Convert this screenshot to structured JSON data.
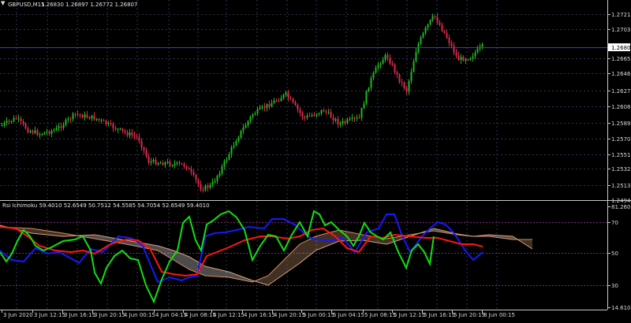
{
  "header": {
    "arrow_icon": "triangle-down-icon",
    "symbol": "GBPUSD,M15",
    "ohlc": "1.26830 1.26897 1.26772 1.26807"
  },
  "main_chart": {
    "price_ticks": [
      "1.27215",
      "1.27030",
      "1.26650",
      "1.26460",
      "1.26270",
      "1.26080",
      "1.25890",
      "1.25700",
      "1.25510",
      "1.25325",
      "1.25135",
      "1.24945"
    ],
    "current_price_label": "1.26807",
    "colors": {
      "bull": "#1fb81f",
      "bear": "#e0284d",
      "grid": "#2f3550",
      "axis": "#c8c8c8",
      "price_line": "#3d3dc0",
      "price_label_bg": "#ffffff"
    }
  },
  "indicator": {
    "title": "Rsi Ichimoku 59.4010 52.6549 50.7512 54.5585 54.7054 52.6549 59.4010",
    "level_ticks": [
      "81.2602",
      "70",
      "50",
      "30",
      "14.6105"
    ],
    "colors": {
      "rsi": "#11e011",
      "blue": "#1818ff",
      "red": "#ff1414",
      "orange_line": "#e08a55",
      "cloud_bull": "#d9a27a",
      "cloud_bear": "#ffffff",
      "level": "#7a2a6f"
    }
  },
  "time_axis": {
    "labels": [
      "3 Jun 2020",
      "3 Jun 12:15",
      "3 Jun 16:15",
      "3 Jun 20:15",
      "4 Jun 00:15",
      "4 Jun 04:15",
      "4 Jun 08:15",
      "4 Jun 12:15",
      "4 Jun 16:15",
      "4 Jun 20:15",
      "5 Jun 00:15",
      "5 Jun 04:15",
      "5 Jun 08:15",
      "5 Jun 12:15",
      "5 Jun 16:15",
      "5 Jun 20:15",
      "8 Jun 00:15"
    ]
  }
}
